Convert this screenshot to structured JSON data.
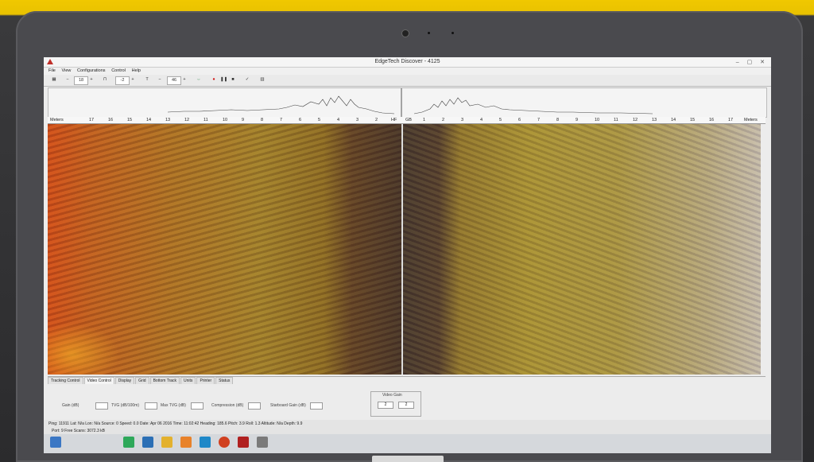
{
  "window": {
    "title": "EdgeTech Discover - 4125"
  },
  "menu": [
    "File",
    "View",
    "Configurations",
    "Control",
    "Help"
  ],
  "toolbar": {
    "range": "18",
    "gain": "-2",
    "zoom": "46"
  },
  "ruler_left": {
    "label": "Meters",
    "ticks": [
      "17",
      "16",
      "15",
      "14",
      "13",
      "12",
      "11",
      "10",
      "9",
      "8",
      "7",
      "6",
      "5",
      "4",
      "3",
      "2",
      "HF"
    ]
  },
  "ruler_right": {
    "label": "Meters",
    "ticks": [
      "GB",
      "1",
      "2",
      "3",
      "4",
      "5",
      "6",
      "7",
      "8",
      "9",
      "10",
      "11",
      "12",
      "13",
      "14",
      "15",
      "16",
      "17"
    ]
  },
  "tabs": [
    "Tracking Control",
    "Video Control",
    "Display",
    "Grid",
    "Bottom Track",
    "Units",
    "Printer",
    "Status"
  ],
  "controls": {
    "gain_label": "Gain (dB)",
    "tvg_label": "TVG (dB/100m)",
    "max_tvg_label": "Max TVG (dB)",
    "compression_label": "Compression (dB)",
    "starboard_gain_label": "Starboard Gain (dB)",
    "video_gain_label": "Video Gain",
    "video_gain_left": "2",
    "video_gain_right": "2"
  },
  "status": {
    "line1": "Ping: 11911   Lat: N/a   Lon: N/a   Source: 0   Speed: 0.0   Date: Apr 06 2016   Time: 11:02:42   Heading: 185.6   Pitch: 3.9   Roll: 1.3   Altitude: N/a   Depth: 9.9",
    "line2": "Port: 9        Free Scans: 3072.3 kB"
  },
  "colors": {
    "port_accent": "#d8471c",
    "starboard_accent": "#a89038"
  }
}
